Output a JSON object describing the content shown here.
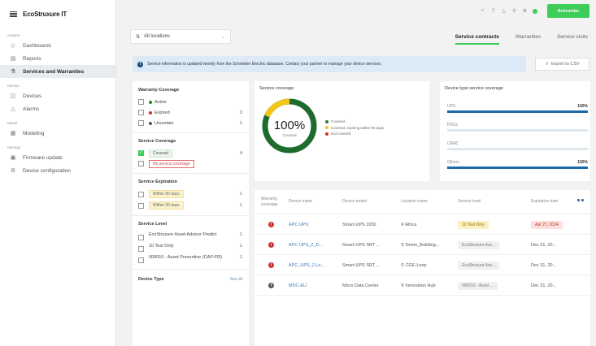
{
  "brand": {
    "name": "EcoStruxure IT"
  },
  "sidebar": {
    "sections": [
      {
        "label": "Analyze",
        "items": [
          {
            "label": "Dashboards",
            "icon": "dashboard-icon",
            "active": false,
            "sub": true
          },
          {
            "label": "Reports",
            "icon": "report-icon",
            "active": false,
            "sub": false
          },
          {
            "label": "Services and Warranties",
            "icon": "service-icon",
            "active": true,
            "sub": false
          }
        ]
      },
      {
        "label": "Monitor",
        "items": [
          {
            "label": "Devices",
            "icon": "devices-icon",
            "active": false,
            "sub": false
          },
          {
            "label": "Alarms",
            "icon": "alarm-icon",
            "active": false,
            "sub": false
          }
        ]
      },
      {
        "label": "Model",
        "items": [
          {
            "label": "Modeling",
            "icon": "modeling-icon",
            "active": false,
            "sub": false
          }
        ]
      },
      {
        "label": "Manage",
        "items": [
          {
            "label": "Firmware update",
            "icon": "firmware-icon",
            "active": false,
            "sub": false
          },
          {
            "label": "Device configuration",
            "icon": "config-icon",
            "active": false,
            "sub": false
          }
        ]
      }
    ]
  },
  "topbar": {
    "icons": [
      "search-icon",
      "help-icon",
      "bell-icon",
      "location-icon",
      "settings-icon"
    ],
    "logo_text": "Schneider"
  },
  "location_select": {
    "value": "All locations"
  },
  "tabs": [
    {
      "label": "Service contracts",
      "active": true
    },
    {
      "label": "Warranties",
      "active": false
    },
    {
      "label": "Service visits",
      "active": false
    }
  ],
  "banner": {
    "text": "Service information is updated weekly from the Schneider Electric database. Contact your partner to manage your device services."
  },
  "export_button": {
    "label": "Export to CSV"
  },
  "filters": {
    "warranty": {
      "title": "Warranty Coverage",
      "items": [
        {
          "label": "Active",
          "color": "#2e7d32",
          "count": ""
        },
        {
          "label": "Expired",
          "color": "#d32f2f",
          "count": "3"
        },
        {
          "label": "Uncertain",
          "color": "#555555",
          "count": "1"
        }
      ]
    },
    "service": {
      "title": "Service Coverage",
      "items": [
        {
          "label": "Covered",
          "style": "green",
          "checked": true,
          "count": "4"
        },
        {
          "label": "No service coverage",
          "style": "redoutline",
          "checked": false,
          "count": ""
        }
      ]
    },
    "expiration": {
      "title": "Service Expiration",
      "items": [
        {
          "label": "Within 90 days",
          "count": "1"
        },
        {
          "label": "Within 30 days",
          "count": "1"
        }
      ]
    },
    "level": {
      "title": "Service Level",
      "items": [
        {
          "label": "EcoStruxure Asset Advisor Predict",
          "count": "1"
        },
        {
          "label": "10 Test Only",
          "count": "1"
        },
        {
          "label": "000010 - Asset Preventive (CAP-FR)",
          "count": "1"
        }
      ]
    },
    "device_type": {
      "title": "Device Type",
      "see_all": "See all"
    }
  },
  "coverage_card": {
    "title": "Service coverage",
    "percent_text": "100%",
    "percent_value": 100,
    "sub_label": "Covered",
    "legend": [
      {
        "label": "Covered",
        "color": "#2e7d32"
      },
      {
        "label": "Covered, expiring within 90 days",
        "color": "#f2c518"
      },
      {
        "label": "Not covered",
        "color": "#d32f2f"
      }
    ]
  },
  "device_type_card": {
    "title": "Device type service coverage",
    "bars": [
      {
        "label": "UPS",
        "pct_text": "100%",
        "pct": 100
      },
      {
        "label": "PDUs",
        "pct_text": "",
        "pct": 0
      },
      {
        "label": "CRAC",
        "pct_text": "",
        "pct": 0
      },
      {
        "label": "Others",
        "pct_text": "100%",
        "pct": 100
      }
    ]
  },
  "table": {
    "headers": [
      "Warranty coverage",
      "Device name",
      "Device model",
      "Location name",
      "Service level",
      "Expiration date"
    ],
    "rows": [
      {
        "status": "expired",
        "status_color": "#d32f2f",
        "name": "APC UPS",
        "model": "Smart-UPS 2200",
        "location": "Africa",
        "level": "10 Test Only",
        "level_style": "yellow",
        "expiration": "Apr 27, 2024",
        "exp_style": "red"
      },
      {
        "status": "expired",
        "status_color": "#d32f2f",
        "name": "APC UPS_2_D...",
        "model": "Smart-UPS SRT ...",
        "location": "Demo_Building...",
        "level": "EcoStruxure Ass...",
        "level_style": "gray",
        "expiration": "Dec 31, 20...",
        "exp_style": ""
      },
      {
        "status": "expired",
        "status_color": "#d32f2f",
        "name": "APC_UPS_2.Lo...",
        "model": "Smart-UPS SRT ...",
        "location": "CGE-Loop",
        "level": "EcoStruxure Ass...",
        "level_style": "gray",
        "expiration": "Dec 31, 20...",
        "exp_style": ""
      },
      {
        "status": "uncertain",
        "status_color": "#555555",
        "name": "MDC-EU",
        "model": "Micro Data Center",
        "location": "Innovation Hub",
        "level": "000010 - Asset ...",
        "level_style": "gray",
        "expiration": "Dec 31, 20...",
        "exp_style": ""
      }
    ]
  }
}
